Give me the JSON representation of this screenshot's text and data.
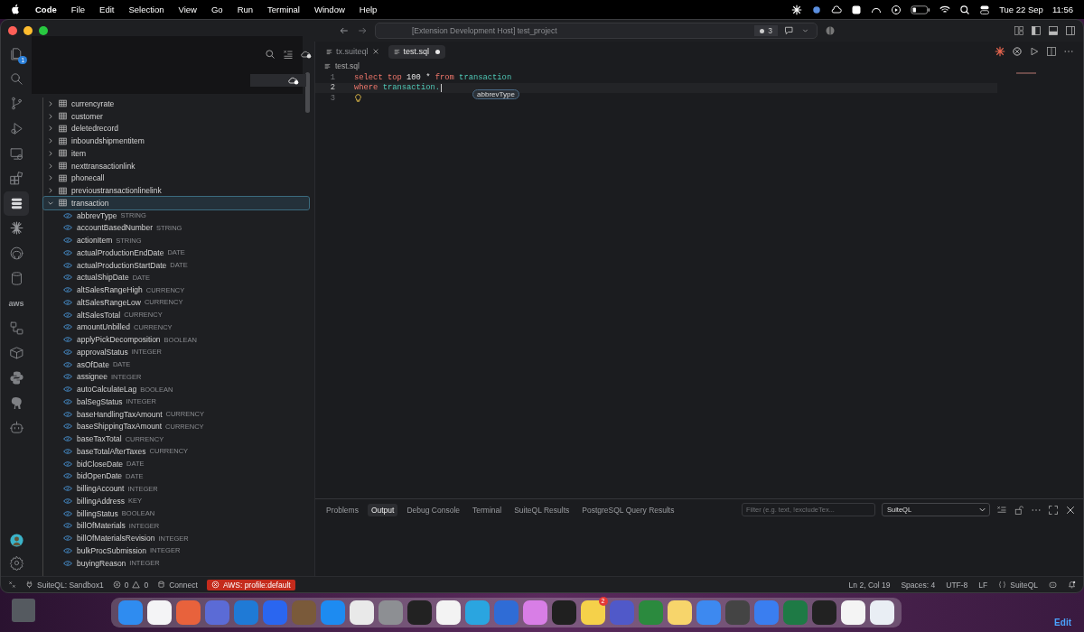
{
  "menu_bar": {
    "app_name": "Code",
    "menus": [
      "File",
      "Edit",
      "Selection",
      "View",
      "Go",
      "Run",
      "Terminal",
      "Window",
      "Help"
    ],
    "date": "Tue 22 Sep",
    "time": "11:56"
  },
  "title_bar": {
    "title": "[Extension Development Host] test_project",
    "changes_count": "3"
  },
  "activity_bar": {
    "items": [
      {
        "kind": "files",
        "selected": false,
        "badge": "1"
      },
      {
        "kind": "search",
        "selected": false
      },
      {
        "kind": "branch",
        "selected": false
      },
      {
        "kind": "debug",
        "selected": false
      },
      {
        "kind": "remote",
        "selected": false
      },
      {
        "kind": "extensions",
        "selected": false
      },
      {
        "kind": "database",
        "selected": true
      },
      {
        "kind": "sparkle",
        "selected": false
      },
      {
        "kind": "octo",
        "selected": false
      },
      {
        "kind": "cylinder",
        "selected": false
      },
      {
        "kind": "aws",
        "label": "aws",
        "selected": false
      },
      {
        "kind": "diagram",
        "selected": false
      },
      {
        "kind": "box",
        "selected": false
      },
      {
        "kind": "snake",
        "selected": false
      },
      {
        "kind": "elephant",
        "selected": false
      },
      {
        "kind": "robot",
        "selected": false
      }
    ],
    "bottom": [
      {
        "kind": "avatar"
      },
      {
        "kind": "gear"
      }
    ]
  },
  "sidebar": {
    "tables": [
      {
        "name": "currencyrate",
        "expanded": false,
        "selected": false
      },
      {
        "name": "customer",
        "expanded": false,
        "selected": false
      },
      {
        "name": "deletedrecord",
        "expanded": false,
        "selected": false
      },
      {
        "name": "inboundshipmentitem",
        "expanded": false,
        "selected": false
      },
      {
        "name": "item",
        "expanded": false,
        "selected": false
      },
      {
        "name": "nexttransactionlink",
        "expanded": false,
        "selected": false
      },
      {
        "name": "phonecall",
        "expanded": false,
        "selected": false
      },
      {
        "name": "previoustransactionlinelink",
        "expanded": false,
        "selected": false
      },
      {
        "name": "transaction",
        "expanded": true,
        "selected": true,
        "children": [
          {
            "name": "abbrevType",
            "type": "STRING"
          },
          {
            "name": "accountBasedNumber",
            "type": "STRING"
          },
          {
            "name": "actionItem",
            "type": "STRING"
          },
          {
            "name": "actualProductionEndDate",
            "type": "DATE"
          },
          {
            "name": "actualProductionStartDate",
            "type": "DATE"
          },
          {
            "name": "actualShipDate",
            "type": "DATE"
          },
          {
            "name": "altSalesRangeHigh",
            "type": "CURRENCY"
          },
          {
            "name": "altSalesRangeLow",
            "type": "CURRENCY"
          },
          {
            "name": "altSalesTotal",
            "type": "CURRENCY"
          },
          {
            "name": "amountUnbilled",
            "type": "CURRENCY"
          },
          {
            "name": "applyPickDecomposition",
            "type": "BOOLEAN"
          },
          {
            "name": "approvalStatus",
            "type": "INTEGER"
          },
          {
            "name": "asOfDate",
            "type": "DATE"
          },
          {
            "name": "assignee",
            "type": "INTEGER"
          },
          {
            "name": "autoCalculateLag",
            "type": "BOOLEAN"
          },
          {
            "name": "balSegStatus",
            "type": "INTEGER"
          },
          {
            "name": "baseHandlingTaxAmount",
            "type": "CURRENCY"
          },
          {
            "name": "baseShippingTaxAmount",
            "type": "CURRENCY"
          },
          {
            "name": "baseTaxTotal",
            "type": "CURRENCY"
          },
          {
            "name": "baseTotalAfterTaxes",
            "type": "CURRENCY"
          },
          {
            "name": "bidCloseDate",
            "type": "DATE"
          },
          {
            "name": "bidOpenDate",
            "type": "DATE"
          },
          {
            "name": "billingAccount",
            "type": "INTEGER"
          },
          {
            "name": "billingAddress",
            "type": "KEY"
          },
          {
            "name": "billingStatus",
            "type": "BOOLEAN"
          },
          {
            "name": "billOfMaterials",
            "type": "INTEGER"
          },
          {
            "name": "billOfMaterialsRevision",
            "type": "INTEGER"
          },
          {
            "name": "bulkProcSubmission",
            "type": "INTEGER"
          },
          {
            "name": "buyingReason",
            "type": "INTEGER"
          }
        ]
      }
    ]
  },
  "editor": {
    "tabs": [
      {
        "label": "tx.suiteql",
        "selected": false,
        "modified": false
      },
      {
        "label": "test.sql",
        "selected": true,
        "modified": true
      }
    ],
    "breadcrumb": "test.sql",
    "lines": [
      {
        "number": "1",
        "current": false,
        "tokens": [
          {
            "kind": "keyword",
            "text": "select"
          },
          {
            "kind": "keyword",
            "text": "top"
          },
          {
            "kind": "number",
            "text": "100"
          },
          {
            "kind": "operator",
            "text": "*"
          },
          {
            "kind": "keyword",
            "text": "from"
          },
          {
            "kind": "identifier",
            "text": "transaction"
          }
        ]
      },
      {
        "number": "2",
        "current": true,
        "tokens": [
          {
            "kind": "keyword",
            "text": "where"
          },
          {
            "kind": "identifier",
            "text": "transaction."
          }
        ]
      },
      {
        "number": "3",
        "current": false,
        "lightbulb": true
      }
    ],
    "suggestion": "abbrevType"
  },
  "panel": {
    "tabs": [
      {
        "label": "Problems",
        "selected": false
      },
      {
        "label": "Output",
        "selected": true
      },
      {
        "label": "Debug Console",
        "selected": false
      },
      {
        "label": "Terminal",
        "selected": false
      },
      {
        "label": "SuiteQL Results",
        "selected": false
      },
      {
        "label": "PostgreSQL Query Results",
        "selected": false
      }
    ],
    "filter": {
      "placeholder": "Filter (e.g. text, !excludeTex..."
    },
    "channel": "SuiteQL"
  },
  "status_bar": {
    "connection": "SuiteQL: Sandbox1",
    "errors": "0",
    "warnings": "0",
    "connect": "Connect",
    "aws_profile": "AWS: profile:default",
    "position": "Ln 2, Col 19",
    "indentation": "Spaces: 4",
    "encoding": "UTF-8",
    "line_ending": "LF",
    "language": "SuiteQL"
  },
  "dock": {
    "notification_badge": "2",
    "desktop_label": "Edit"
  }
}
